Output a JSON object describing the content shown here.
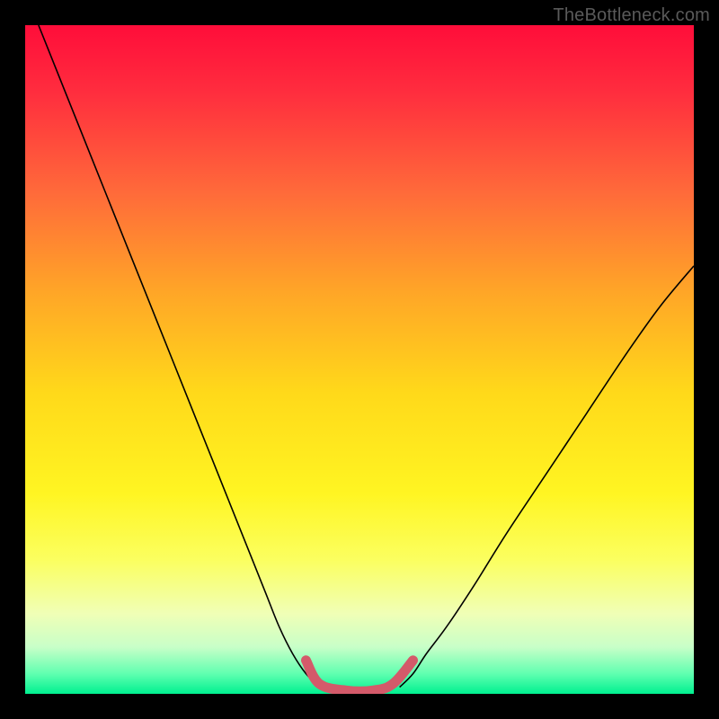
{
  "watermark": "TheBottleneck.com",
  "chart_data": {
    "type": "line",
    "title": "",
    "xlabel": "",
    "ylabel": "",
    "xlim": [
      0,
      100
    ],
    "ylim": [
      0,
      100
    ],
    "series": [
      {
        "name": "curve-left",
        "x": [
          2,
          6,
          10,
          14,
          18,
          22,
          26,
          30,
          34,
          36,
          38,
          40,
          42,
          44
        ],
        "y": [
          100,
          90,
          80,
          70,
          60,
          50,
          40,
          30,
          20,
          15,
          10,
          6,
          3,
          1
        ],
        "stroke": "#000000",
        "strokeWidth": 1.6
      },
      {
        "name": "curve-right",
        "x": [
          56,
          58,
          60,
          63,
          67,
          72,
          78,
          84,
          90,
          95,
          100
        ],
        "y": [
          1,
          3,
          6,
          10,
          16,
          24,
          33,
          42,
          51,
          58,
          64
        ],
        "stroke": "#000000",
        "strokeWidth": 1.6
      },
      {
        "name": "valley-highlight",
        "x": [
          42,
          44,
          48,
          52,
          55,
          58
        ],
        "y": [
          5,
          1.5,
          0.5,
          0.5,
          1.5,
          5
        ],
        "stroke": "#d45a6a",
        "strokeWidth": 11
      }
    ],
    "background_gradient": {
      "stops": [
        {
          "offset": 0.0,
          "color": "#ff0d3a"
        },
        {
          "offset": 0.1,
          "color": "#ff2d3e"
        },
        {
          "offset": 0.25,
          "color": "#ff6a3a"
        },
        {
          "offset": 0.4,
          "color": "#ffa627"
        },
        {
          "offset": 0.55,
          "color": "#ffd91a"
        },
        {
          "offset": 0.7,
          "color": "#fff522"
        },
        {
          "offset": 0.8,
          "color": "#fbff60"
        },
        {
          "offset": 0.88,
          "color": "#f0ffb6"
        },
        {
          "offset": 0.93,
          "color": "#c8ffc8"
        },
        {
          "offset": 0.97,
          "color": "#60ffb0"
        },
        {
          "offset": 1.0,
          "color": "#00f090"
        }
      ]
    }
  }
}
